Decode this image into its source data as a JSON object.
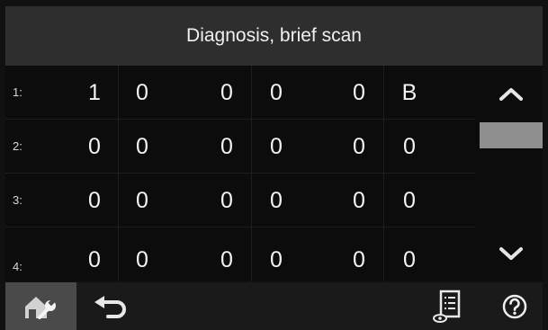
{
  "header": {
    "title": "Diagnosis, brief scan"
  },
  "rows": [
    {
      "label": "1:",
      "cells": [
        "1",
        "0",
        "0",
        "0",
        "0",
        "B"
      ]
    },
    {
      "label": "2:",
      "cells": [
        "0",
        "0",
        "0",
        "0",
        "0",
        "0"
      ]
    },
    {
      "label": "3:",
      "cells": [
        "0",
        "0",
        "0",
        "0",
        "0",
        "0"
      ]
    },
    {
      "label": "4:",
      "cells": [
        "0",
        "0",
        "0",
        "0",
        "0",
        "0"
      ]
    }
  ],
  "icons": {
    "scroll_up": "chevron-up-icon",
    "scroll_down": "chevron-down-icon",
    "home": "home-wrench-icon",
    "back": "back-arrow-icon",
    "report": "report-list-icon",
    "help": "help-icon"
  },
  "colors": {
    "title_bg": "#2e2e2e",
    "screen_bg": "#0c0c0c",
    "home_active_bg": "#4a4a4a",
    "scroll_thumb": "#8f8f8f",
    "text": "#f2f2f2"
  }
}
